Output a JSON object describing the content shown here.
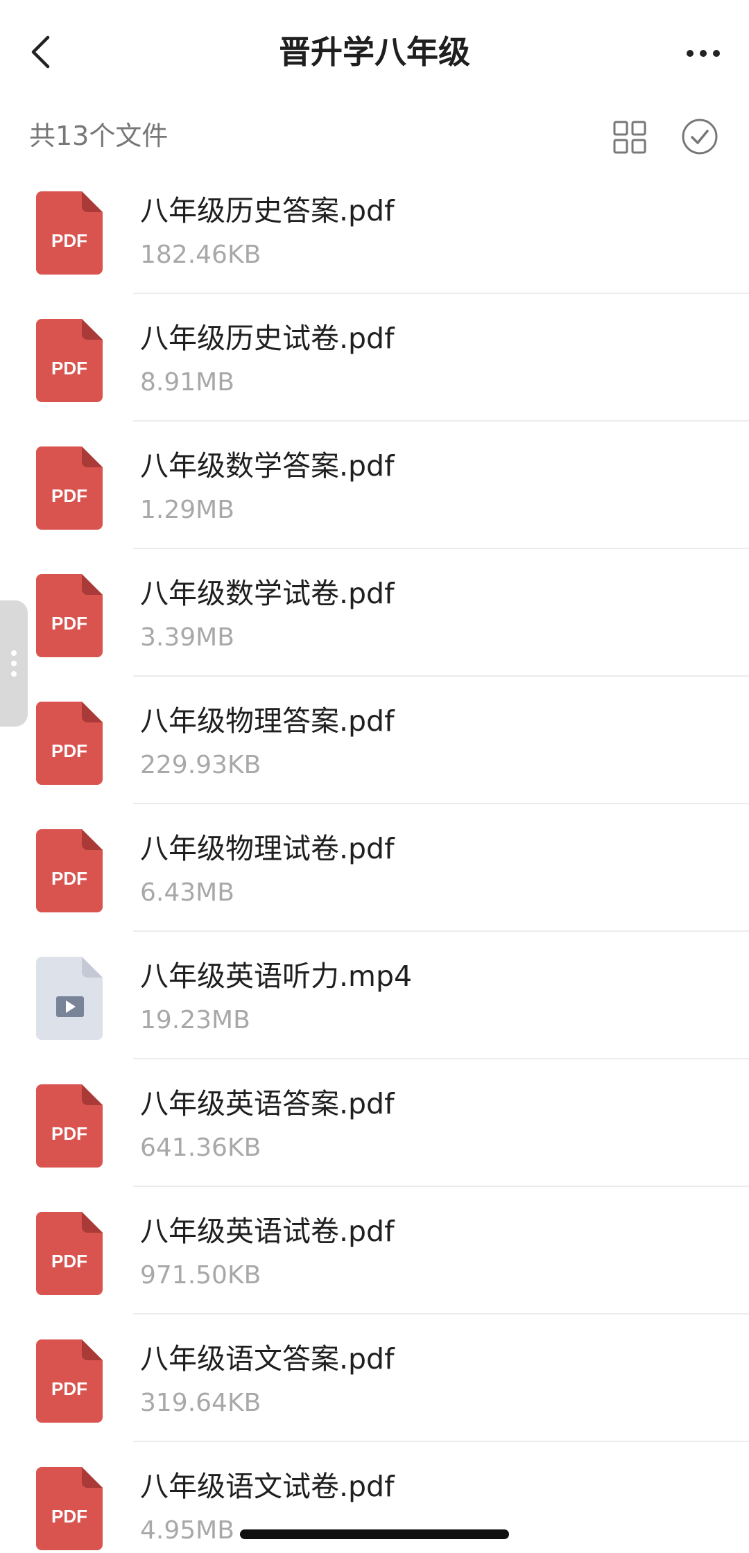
{
  "header": {
    "title": "晋升学八年级",
    "back_icon": "chevron-left-icon",
    "more_icon": "more-horizontal-icon"
  },
  "toolbar": {
    "file_count": "共13个文件",
    "grid_icon": "grid-view-icon",
    "select_icon": "check-circle-icon"
  },
  "colors": {
    "pdf_red": "#d9534f",
    "video_bg": "#dde1ea",
    "video_accent": "#7a8499",
    "divider": "#ececec",
    "secondary_text": "#a8a8a8"
  },
  "files": [
    {
      "name": "八年级历史答案.pdf",
      "size": "182.46KB",
      "type": "pdf",
      "icon_label": "PDF"
    },
    {
      "name": "八年级历史试卷.pdf",
      "size": "8.91MB",
      "type": "pdf",
      "icon_label": "PDF"
    },
    {
      "name": "八年级数学答案.pdf",
      "size": "1.29MB",
      "type": "pdf",
      "icon_label": "PDF"
    },
    {
      "name": "八年级数学试卷.pdf",
      "size": "3.39MB",
      "type": "pdf",
      "icon_label": "PDF"
    },
    {
      "name": "八年级物理答案.pdf",
      "size": "229.93KB",
      "type": "pdf",
      "icon_label": "PDF"
    },
    {
      "name": "八年级物理试卷.pdf",
      "size": "6.43MB",
      "type": "pdf",
      "icon_label": "PDF"
    },
    {
      "name": "八年级英语听力.mp4",
      "size": "19.23MB",
      "type": "video",
      "icon_label": ""
    },
    {
      "name": "八年级英语答案.pdf",
      "size": "641.36KB",
      "type": "pdf",
      "icon_label": "PDF"
    },
    {
      "name": "八年级英语试卷.pdf",
      "size": "971.50KB",
      "type": "pdf",
      "icon_label": "PDF"
    },
    {
      "name": "八年级语文答案.pdf",
      "size": "319.64KB",
      "type": "pdf",
      "icon_label": "PDF"
    },
    {
      "name": "八年级语文试卷.pdf",
      "size": "4.95MB",
      "type": "pdf",
      "icon_label": "PDF"
    }
  ]
}
